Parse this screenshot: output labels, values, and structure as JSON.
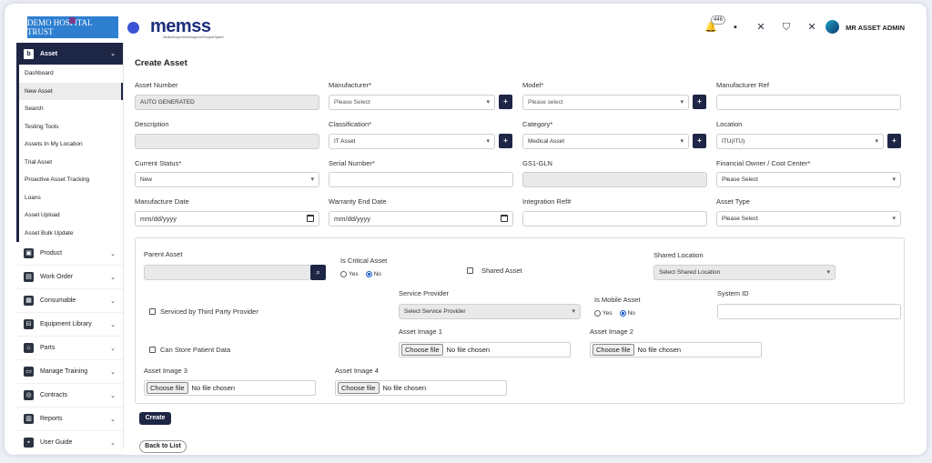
{
  "header": {
    "hospital_logo": "DEMO HOSPITAL TRUST",
    "app_logo": "memss",
    "app_logo_tagline": "Medical Equipment Management Support System",
    "notification_count": "446",
    "user_name": "MR ASSET ADMIN"
  },
  "sidebar": {
    "active_section": "Asset",
    "asset_items": [
      "Dashboard",
      "New Asset",
      "Search",
      "Testing Tools",
      "Assets In My Location",
      "Trial Asset",
      "Proactive Asset Tracking",
      "Loans",
      "Asset Upload",
      "Asset Bulk Update"
    ],
    "sections": [
      "Product",
      "Work Order",
      "Consumable",
      "Equipment Library",
      "Parts",
      "Manage Training",
      "Contracts",
      "Reports",
      "User Guide"
    ]
  },
  "form": {
    "title": "Create Asset",
    "asset_number": {
      "label": "Asset Number",
      "value": "AUTO GENERATED"
    },
    "manufacturer": {
      "label": "Manufacturer*",
      "value": "Please Select"
    },
    "model": {
      "label": "Model*",
      "value": "Please select"
    },
    "manufacturer_ref": {
      "label": "Manufacturer Ref",
      "value": ""
    },
    "description": {
      "label": "Description",
      "value": ""
    },
    "classification": {
      "label": "Classification*",
      "value": "IT Asset"
    },
    "category": {
      "label": "Category*",
      "value": "Medical Asset"
    },
    "location": {
      "label": "Location",
      "value": "ITU(ITU)"
    },
    "current_status": {
      "label": "Current Status*",
      "value": "New"
    },
    "serial_number": {
      "label": "Serial Number*",
      "value": ""
    },
    "gs1_gln": {
      "label": "GS1-GLN",
      "value": ""
    },
    "financial_owner": {
      "label": "Financial Owner / Cost Center*",
      "value": "Please Select"
    },
    "manufacture_date": {
      "label": "Manufacture Date",
      "value": "mm/dd/yyyy"
    },
    "warranty_end_date": {
      "label": "Warranty End Date",
      "value": "mm/dd/yyyy"
    },
    "integration_ref": {
      "label": "Integration Ref#",
      "value": ""
    },
    "asset_type": {
      "label": "Asset Type",
      "value": "Please Select"
    },
    "add_label": "+"
  },
  "panel": {
    "parent_asset": {
      "label": "Parent Asset",
      "value": ""
    },
    "is_critical": {
      "label": "Is Critical Asset",
      "yes": "Yes",
      "no": "No",
      "selected": "No"
    },
    "shared_asset": {
      "label": "Shared Asset",
      "checked": false
    },
    "shared_location": {
      "label": "Shared Location",
      "value": "Select Shared Location"
    },
    "serviced_third_party": {
      "label": "Serviced by Third Party Provider",
      "checked": false
    },
    "service_provider": {
      "label": "Service Provider",
      "value": "Select Service Provider"
    },
    "is_mobile": {
      "label": "Is Mobile Asset",
      "yes": "Yes",
      "no": "No",
      "selected": "No"
    },
    "system_id": {
      "label": "System ID",
      "value": ""
    },
    "store_patient_data": {
      "label": "Can Store Patient Data",
      "checked": false
    },
    "image1": {
      "label": "Asset Image 1"
    },
    "image2": {
      "label": "Asset Image 2"
    },
    "image3": {
      "label": "Asset Image 3"
    },
    "image4": {
      "label": "Asset Image 4"
    },
    "choose_file": "Choose file",
    "no_file": "No file chosen"
  },
  "actions": {
    "create": "Create",
    "back": "Back to List"
  }
}
